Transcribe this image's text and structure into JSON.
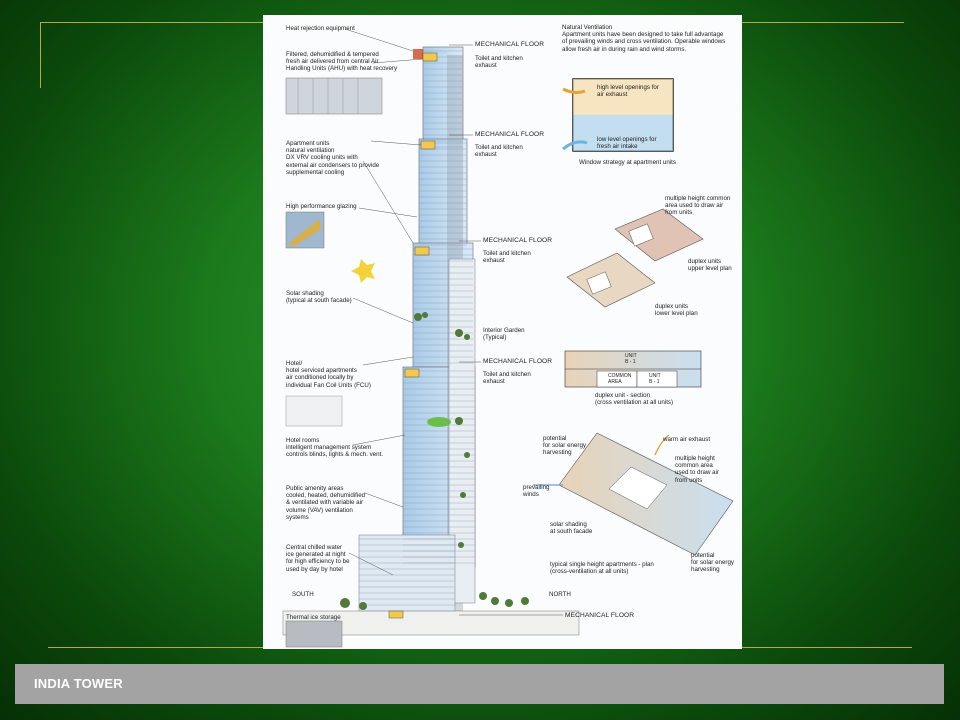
{
  "slide": {
    "footer_title": "INDIA TOWER"
  },
  "diagram": {
    "left_labels": [
      "Heat rejection equipment",
      "Filtered, dehumidified & tempered\nfresh air delivered from central Air\nHandling Units (AHU) with heat recovery",
      "Apartment units\nnatural ventilation\nDX VRV cooling units with\nexternal air condensers to provide\nsupplemental cooling",
      "High performance glazing",
      "Solar shading\n(typical at south facade)",
      "Hotel/\nhotel serviced apartments\nair conditioned locally by\nindividual Fan Coil Units (FCU)",
      "Hotel rooms\nintelligent management system\ncontrols blinds, lights & mech. vent.",
      "Public amenity areas\ncooled, heated, dehumidified\n& ventilated with variable air\nvolume (VAV) ventilation\nsystems",
      "Central chilled water\nice generated at night\nfor high efficiency to be\nused by day by hotel",
      "Thermal ice storage"
    ],
    "mechanical_floor": "MECHANICAL FLOOR",
    "exhaust": "Toilet and kitchen\nexhaust",
    "interior_garden": "Interior Garden\n(Typical)",
    "ahu": "AHU",
    "south": "SOUTH",
    "north": "NORTH",
    "natural_ventilation": "Natural Ventilation\nApartment units have been designed to take full advantage\nof prevailing winds and cross ventilation. Operable windows\nallow fresh air in during rain and wind storms.",
    "window_high": "high level openings for\nair exhaust",
    "window_low": "low level openings for\nfresh air intake",
    "window_caption": "Window strategy at apartment units",
    "duplex_common": "multiple height common\narea used to draw air\nfrom units",
    "duplex_upper": "duplex units\nupper level plan",
    "duplex_lower": "duplex units\nlower level plan",
    "section_unit_top": "UNIT\nB - 1",
    "section_common": "COMMON\nAREA",
    "section_unit_bottom": "UNIT\nB - 1",
    "section_caption": "duplex unit - section\n(cross ventilation at all units)",
    "plan_potential_top": "potential\nfor solar energy\nharvesting",
    "plan_warm_air": "warm air exhaust",
    "plan_common": "multiple height\ncommon area\nused to draw air\nfrom units",
    "plan_prevailing": "prevailing\nwinds",
    "plan_shading": "solar shading\nat south facade",
    "plan_potential_bottom": "potential\nfor solar energy\nharvesting",
    "plan_caption": "typical single height apartments - plan\n(cross-ventilation at all units)"
  }
}
